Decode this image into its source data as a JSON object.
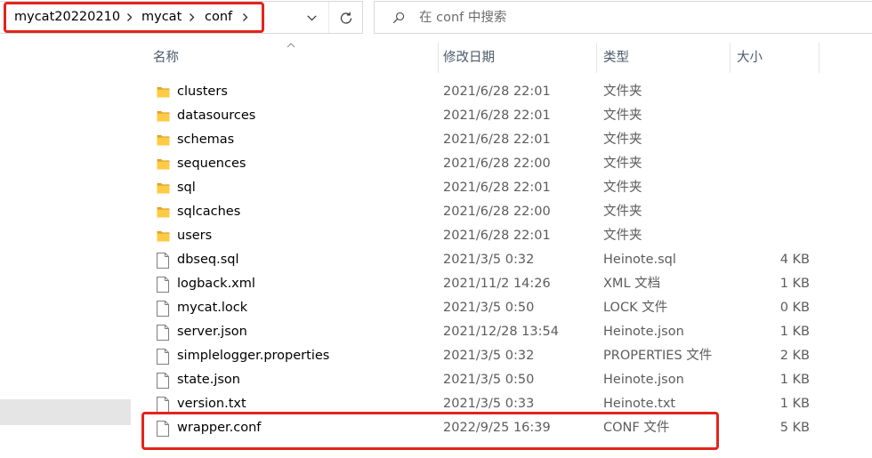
{
  "address_bar": {
    "highlighted": true,
    "breadcrumb": [
      {
        "label": "mycat20220210",
        "separator_icon": "chevron-right-icon"
      },
      {
        "label": "mycat",
        "separator_icon": "chevron-right-icon"
      },
      {
        "label": "conf",
        "separator_icon": "chevron-right-icon"
      }
    ],
    "recent_locations_icon": "chevron-down-icon",
    "refresh_icon": "refresh-icon"
  },
  "search": {
    "icon": "search-icon",
    "placeholder": "在 conf 中搜索"
  },
  "columns": [
    {
      "label": "名称",
      "sort_icon": "sort-ascending-icon"
    },
    {
      "label": "修改日期"
    },
    {
      "label": "类型"
    },
    {
      "label": "大小"
    }
  ],
  "files": [
    {
      "icon": "folder-icon",
      "name": "clusters",
      "modified": "2021/6/28 22:01",
      "type": "文件夹"
    },
    {
      "icon": "folder-icon",
      "name": "datasources",
      "modified": "2021/6/28 22:01",
      "type": "文件夹"
    },
    {
      "icon": "folder-icon",
      "name": "schemas",
      "modified": "2021/6/28 22:01",
      "type": "文件夹"
    },
    {
      "icon": "folder-icon",
      "name": "sequences",
      "modified": "2021/6/28 22:00",
      "type": "文件夹"
    },
    {
      "icon": "folder-icon",
      "name": "sql",
      "modified": "2021/6/28 22:01",
      "type": "文件夹"
    },
    {
      "icon": "folder-icon",
      "name": "sqlcaches",
      "modified": "2021/6/28 22:00",
      "type": "文件夹"
    },
    {
      "icon": "folder-icon",
      "name": "users",
      "modified": "2021/6/28 22:01",
      "type": "文件夹"
    },
    {
      "icon": "file-icon",
      "name": "dbseq.sql",
      "modified": "2021/3/5 0:32",
      "type": "Heinote.sql",
      "size": "4 KB"
    },
    {
      "icon": "file-icon",
      "name": "logback.xml",
      "modified": "2021/11/2 14:26",
      "type": "XML 文档",
      "size": "1 KB"
    },
    {
      "icon": "file-icon",
      "name": "mycat.lock",
      "modified": "2021/3/5 0:50",
      "type": "LOCK 文件",
      "size": "0 KB"
    },
    {
      "icon": "file-icon",
      "name": "server.json",
      "modified": "2021/12/28 13:54",
      "type": "Heinote.json",
      "size": "1 KB"
    },
    {
      "icon": "file-icon",
      "name": "simplelogger.properties",
      "modified": "2021/3/5 0:32",
      "type": "PROPERTIES 文件",
      "size": "2 KB"
    },
    {
      "icon": "file-icon",
      "name": "state.json",
      "modified": "2021/3/5 0:50",
      "type": "Heinote.json",
      "size": "1 KB"
    },
    {
      "icon": "file-icon",
      "name": "version.txt",
      "modified": "2021/3/5 0:33",
      "type": "Heinote.txt",
      "size": "1 KB"
    },
    {
      "icon": "file-icon",
      "name": "wrapper.conf",
      "modified": "2022/9/25 16:39",
      "type": "CONF 文件",
      "size": "5 KB",
      "highlighted": true
    }
  ],
  "colors": {
    "annotation": "#e3241c",
    "folder": "#ffcb45",
    "folder_tab": "#e0a52c"
  }
}
